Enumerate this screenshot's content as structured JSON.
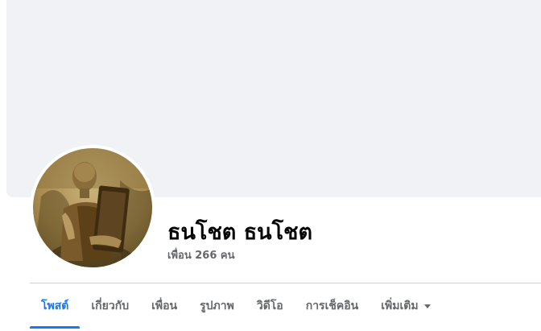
{
  "profile": {
    "name": "ธนโชต ธนโชต",
    "friends_count": "เพื่อน 266 คน"
  },
  "tabs": [
    {
      "label": "โพสต์",
      "active": true
    },
    {
      "label": "เกี่ยวกับ",
      "active": false
    },
    {
      "label": "เพื่อน",
      "active": false
    },
    {
      "label": "รูปภาพ",
      "active": false
    },
    {
      "label": "วิดีโอ",
      "active": false
    },
    {
      "label": "การเช็คอิน",
      "active": false
    },
    {
      "label": "เพิ่มเติม",
      "active": false,
      "icon": "caret-down-icon"
    }
  ],
  "colors": {
    "accent": "#1877f2",
    "cover_bg": "#f0f2f5",
    "text_primary": "#050505",
    "text_secondary": "#65676b"
  }
}
